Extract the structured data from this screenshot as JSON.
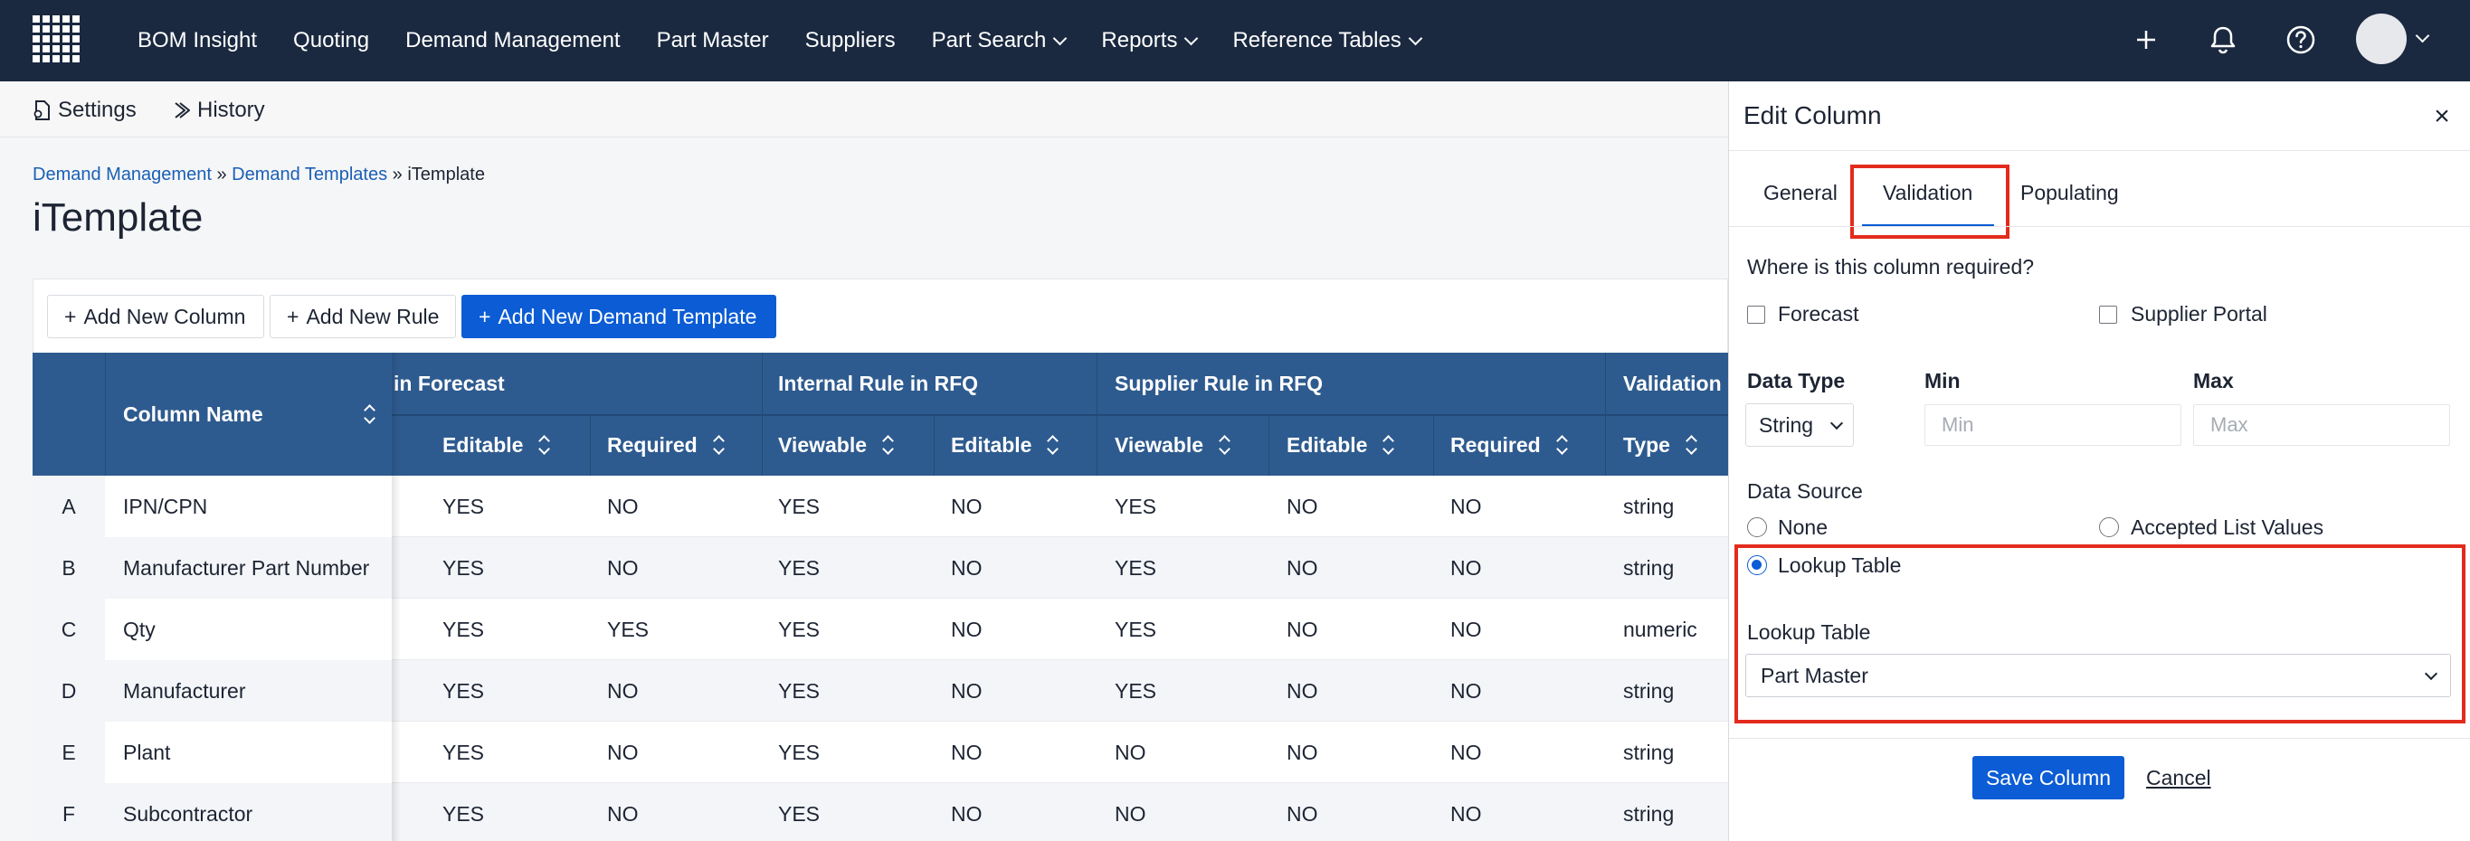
{
  "nav": {
    "items": [
      {
        "label": "BOM Insight",
        "dropdown": false
      },
      {
        "label": "Quoting",
        "dropdown": false
      },
      {
        "label": "Demand Management",
        "dropdown": false
      },
      {
        "label": "Part Master",
        "dropdown": false
      },
      {
        "label": "Suppliers",
        "dropdown": false
      },
      {
        "label": "Part Search",
        "dropdown": true
      },
      {
        "label": "Reports",
        "dropdown": true
      },
      {
        "label": "Reference Tables",
        "dropdown": true
      }
    ],
    "icons": [
      "plus-icon",
      "bell-icon",
      "help-icon",
      "avatar"
    ]
  },
  "subbar": {
    "settings_label": "Settings",
    "history_label": "History"
  },
  "breadcrumb": {
    "items": [
      "Demand Management",
      "Demand Templates"
    ],
    "separator": "»",
    "current": "iTemplate"
  },
  "page": {
    "title": "iTemplate"
  },
  "toolbar": {
    "add_column": "Add New Column",
    "add_rule": "Add New Rule",
    "add_template": "Add New Demand Template"
  },
  "table": {
    "column_name_header": "Column Name",
    "groups": [
      {
        "label": "in Forecast"
      },
      {
        "label": "Internal Rule in RFQ"
      },
      {
        "label": "Supplier Rule in RFQ"
      },
      {
        "label": "Validation"
      }
    ],
    "sub_headers": [
      "Editable",
      "Required",
      "Viewable",
      "Editable",
      "Viewable",
      "Editable",
      "Required",
      "Type"
    ],
    "rows": [
      {
        "idx": "A",
        "name": "IPN/CPN",
        "cells": [
          "YES",
          "NO",
          "YES",
          "NO",
          "YES",
          "NO",
          "NO",
          "string"
        ]
      },
      {
        "idx": "B",
        "name": "Manufacturer Part Number",
        "cells": [
          "YES",
          "NO",
          "YES",
          "NO",
          "YES",
          "NO",
          "NO",
          "string"
        ]
      },
      {
        "idx": "C",
        "name": "Qty",
        "cells": [
          "YES",
          "YES",
          "YES",
          "NO",
          "YES",
          "NO",
          "NO",
          "numeric"
        ]
      },
      {
        "idx": "D",
        "name": "Manufacturer",
        "cells": [
          "YES",
          "NO",
          "YES",
          "NO",
          "YES",
          "NO",
          "NO",
          "string"
        ]
      },
      {
        "idx": "E",
        "name": "Plant",
        "cells": [
          "YES",
          "NO",
          "YES",
          "NO",
          "NO",
          "NO",
          "NO",
          "string"
        ]
      },
      {
        "idx": "F",
        "name": "Subcontractor",
        "cells": [
          "YES",
          "NO",
          "YES",
          "NO",
          "NO",
          "NO",
          "NO",
          "string"
        ]
      }
    ]
  },
  "panel": {
    "title": "Edit Column",
    "tabs": [
      "General",
      "Validation",
      "Populating"
    ],
    "active_tab": "Validation",
    "required_question": "Where is this column required?",
    "required_options": [
      {
        "label": "Forecast",
        "checked": false
      },
      {
        "label": "Supplier Portal",
        "checked": false
      }
    ],
    "data_type_label": "Data Type",
    "data_type_value": "String",
    "min_label": "Min",
    "min_placeholder": "Min",
    "max_label": "Max",
    "max_placeholder": "Max",
    "data_source_label": "Data Source",
    "data_source_options": [
      {
        "label": "None",
        "selected": false
      },
      {
        "label": "Accepted List Values",
        "selected": false
      },
      {
        "label": "Lookup Table",
        "selected": true
      }
    ],
    "lookup_table_label": "Lookup Table",
    "lookup_table_value": "Part Master",
    "save_label": "Save Column",
    "cancel_label": "Cancel"
  },
  "colors": {
    "nav_bg": "#1a2940",
    "table_header_bg": "#2e5b8f",
    "primary": "#0b5cd5",
    "highlight": "#e22b1d"
  }
}
